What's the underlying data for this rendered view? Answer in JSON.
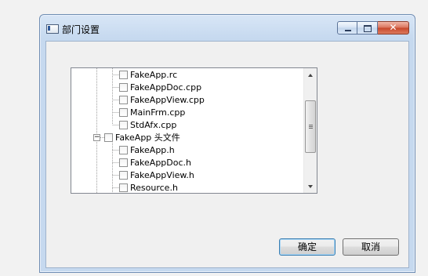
{
  "window": {
    "title": "部门设置"
  },
  "titlebar_buttons": {
    "close_glyph": "✕"
  },
  "tree": {
    "items": [
      {
        "label": "FakeApp.rc",
        "checked": false
      },
      {
        "label": "FakeAppDoc.cpp",
        "checked": false
      },
      {
        "label": "FakeAppView.cpp",
        "checked": false
      },
      {
        "label": "MainFrm.cpp",
        "checked": false
      },
      {
        "label": "StdAfx.cpp",
        "checked": false
      },
      {
        "label": "FakeApp 头文件",
        "checked": false,
        "expander": "−"
      },
      {
        "label": "FakeApp.h",
        "checked": false
      },
      {
        "label": "FakeAppDoc.h",
        "checked": false
      },
      {
        "label": "FakeAppView.h",
        "checked": false
      },
      {
        "label": "Resource.h",
        "checked": false
      }
    ]
  },
  "buttons": {
    "ok_label": "确定",
    "cancel_label": "取消"
  },
  "icons": {
    "app": "app-window-icon",
    "minimize": "minimize-icon",
    "maximize": "maximize-icon",
    "close": "close-icon",
    "scroll_up": "chevron-up-icon",
    "scroll_down": "chevron-down-icon"
  },
  "colors": {
    "title_bar": "#c6d9ef",
    "close_button": "#c7462a",
    "default_button_border": "#3c7fb1"
  }
}
